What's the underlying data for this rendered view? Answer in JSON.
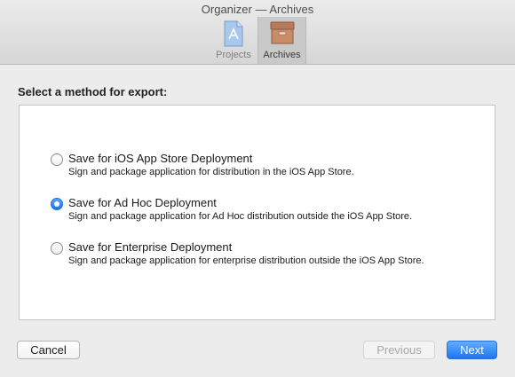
{
  "window": {
    "title": "Organizer — Archives"
  },
  "toolbar": {
    "items": [
      {
        "label": "Projects",
        "icon": "projects-icon",
        "selected": false
      },
      {
        "label": "Archives",
        "icon": "archives-icon",
        "selected": true
      }
    ]
  },
  "export": {
    "heading": "Select a method for export:",
    "selected_index": 1,
    "options": [
      {
        "title": "Save for iOS App Store Deployment",
        "description": "Sign and package application for distribution in the iOS App Store.",
        "checked": false
      },
      {
        "title": "Save for Ad Hoc Deployment",
        "description": "Sign and package application for Ad Hoc distribution outside the iOS App Store.",
        "checked": true
      },
      {
        "title": "Save for Enterprise Deployment",
        "description": "Sign and package application for enterprise distribution outside the iOS App Store.",
        "checked": false
      }
    ]
  },
  "buttons": {
    "cancel": "Cancel",
    "previous": "Previous",
    "next": "Next",
    "previous_enabled": false
  },
  "colors": {
    "accent": "#1e73f0",
    "window_bg": "#ececec",
    "panel_bg": "#ffffff"
  }
}
